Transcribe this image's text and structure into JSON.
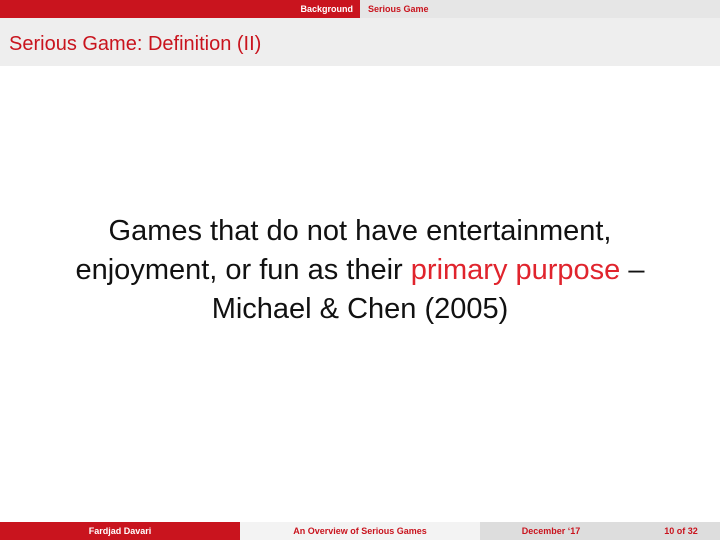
{
  "nav": {
    "sections": [
      "Background",
      "Serious Game"
    ]
  },
  "slide": {
    "title": "Serious Game: Definition (II)",
    "quote_part1": "Games that do not have entertainment,",
    "quote_part2": "enjoyment, or fun as their",
    "quote_highlight": "primary purpose",
    "quote_part3": "–",
    "quote_part4": "Michael & Chen (2005)"
  },
  "footer": {
    "author": "Fardjad Davari",
    "title": "An Overview of Serious Games",
    "date": "December ‘17",
    "page": "10 of 32"
  },
  "colors": {
    "accent": "#c9141e",
    "highlight": "#e0242d"
  }
}
